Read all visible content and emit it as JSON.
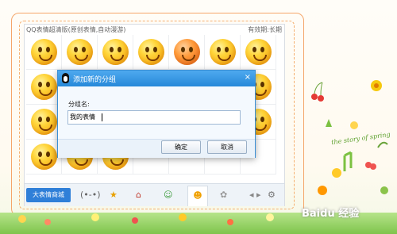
{
  "panel": {
    "title": "QQ表情超清版(原创表情,自动漫游)",
    "validity": "有效期:长期"
  },
  "dialog": {
    "title": "添加新的分组",
    "group_label": "分组名:",
    "group_value": "我的表情",
    "ok_label": "确定",
    "cancel_label": "取消",
    "close_glyph": "×"
  },
  "toolbar": {
    "mall_label": "大表情商城",
    "icons": [
      "(•-•)",
      "★",
      "⌂",
      "☺",
      "☻",
      "✿",
      "◂ ▸",
      "⚙"
    ]
  },
  "decoration": {
    "spring_text": "the story of spring",
    "watermark": "Baidu 经验"
  },
  "colors": {
    "accent": "#2689d9",
    "frame_border": "#f5a66a",
    "mall_button": "#2f7fd8"
  }
}
